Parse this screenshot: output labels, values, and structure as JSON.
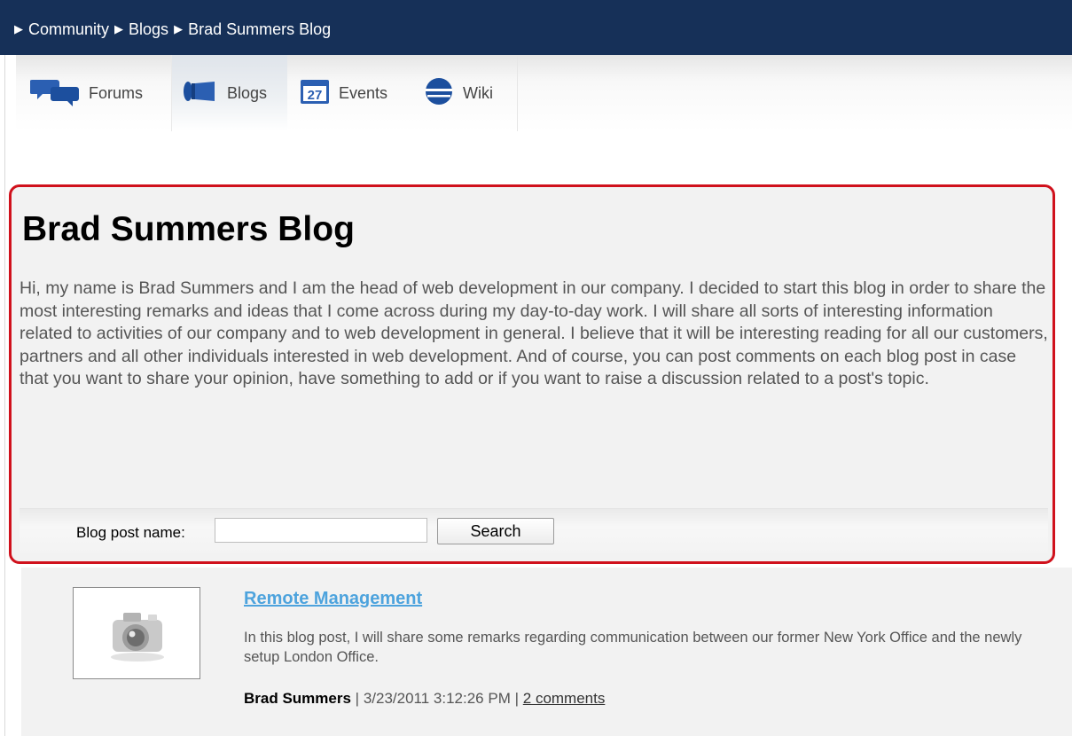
{
  "breadcrumb": {
    "items": [
      "Community",
      "Blogs",
      "Brad Summers Blog"
    ]
  },
  "tabs": [
    {
      "label": "Forums",
      "icon": "forums-icon",
      "selected": false
    },
    {
      "label": "Blogs",
      "icon": "blogs-megaphone-icon",
      "selected": true
    },
    {
      "label": "Events",
      "icon": "calendar-icon",
      "selected": false,
      "icon_text": "27"
    },
    {
      "label": "Wiki",
      "icon": "wiki-globe-icon",
      "selected": false
    }
  ],
  "blog": {
    "title": "Brad Summers Blog",
    "description": "Hi, my name is Brad Summers and I am the head of web development in our company. I decided to start this blog in order to share the most interesting remarks and ideas that I come across during my day-to-day work. I will share all sorts of interesting information related to activities of our company and to web development in general. I believe that it will be interesting reading for all our customers, partners and all other individuals interested in web development. And of course, you can post comments on each blog post in case that you want to share your opinion, have something to add or if you want to raise a discussion related to a post's topic."
  },
  "search": {
    "label": "Blog post name:",
    "value": "",
    "button_label": "Search"
  },
  "posts": [
    {
      "title": "Remote Management",
      "summary": "In this blog post, I will share some remarks regarding communication between our former New York Office and the newly setup London Office.",
      "author": "Brad Summers",
      "separator": "|",
      "date": "3/23/2011 3:12:26 PM",
      "comments": "2 comments",
      "thumbnail_icon": "camera-icon"
    }
  ],
  "colors": {
    "topbar": "#163058",
    "highlight_border": "#d0111c",
    "link": "#4da3dd"
  }
}
